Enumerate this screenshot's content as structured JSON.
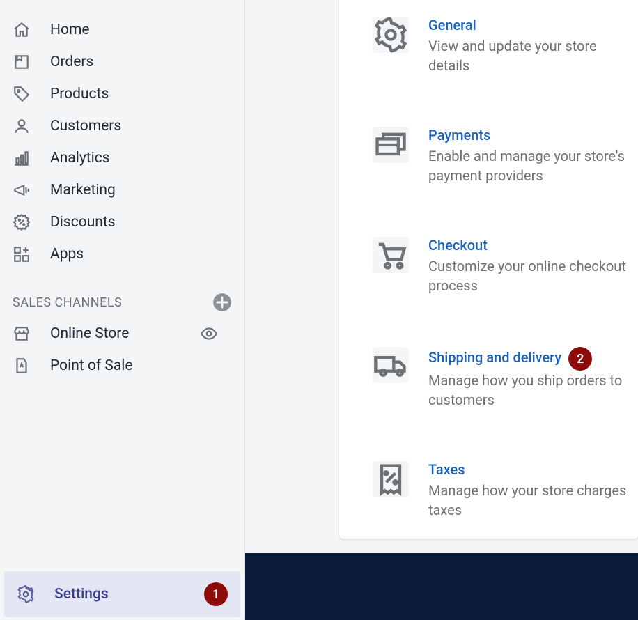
{
  "sidebar": {
    "items": [
      {
        "label": "Home"
      },
      {
        "label": "Orders"
      },
      {
        "label": "Products"
      },
      {
        "label": "Customers"
      },
      {
        "label": "Analytics"
      },
      {
        "label": "Marketing"
      },
      {
        "label": "Discounts"
      },
      {
        "label": "Apps"
      }
    ],
    "section_heading": "SALES CHANNELS",
    "channels": [
      {
        "label": "Online Store"
      },
      {
        "label": "Point of Sale"
      }
    ],
    "settings_label": "Settings",
    "settings_badge": "1"
  },
  "settings": {
    "cards": [
      {
        "title": "General",
        "desc": "View and update your store details"
      },
      {
        "title": "Payments",
        "desc": "Enable and manage your store's payment providers"
      },
      {
        "title": "Checkout",
        "desc": "Customize your online checkout process"
      },
      {
        "title": "Shipping and delivery",
        "desc": "Manage how you ship orders to customers",
        "badge": "2"
      },
      {
        "title": "Taxes",
        "desc": "Manage how your store charges taxes"
      }
    ]
  }
}
